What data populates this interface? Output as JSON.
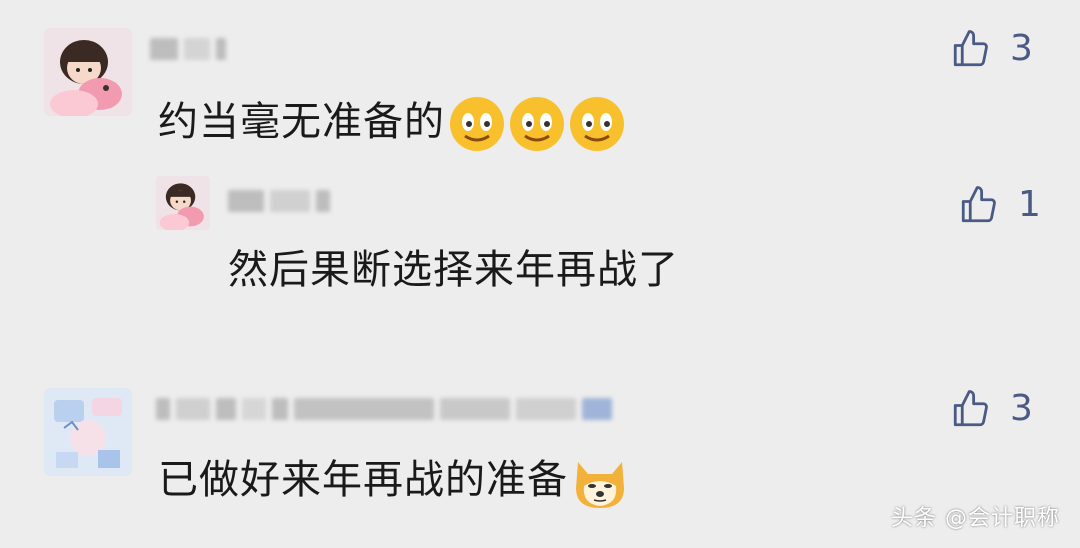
{
  "comments": [
    {
      "text": "约当毫无准备的",
      "likes": "3",
      "avatar_icon": "avatar-girl-pink-icon",
      "emoji": "smiling-face-icon"
    },
    {
      "text": "然后果断选择来年再战了",
      "likes": "1",
      "avatar_icon": "avatar-girl-pink-icon"
    },
    {
      "text": "已做好来年再战的准备",
      "likes": "3",
      "avatar_icon": "avatar-sticker-collage-icon",
      "emoji": "doge-icon"
    }
  ],
  "watermark": "头条 @会计职称",
  "colors": {
    "background": "#ededed",
    "like_blue": "#4a5a85",
    "text": "#1a1a1a"
  }
}
